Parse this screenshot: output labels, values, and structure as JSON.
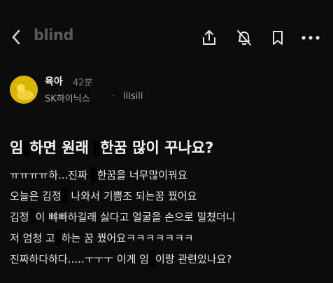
{
  "header": {
    "logo": "blind",
    "icons": [
      "back-chevron-icon",
      "share-icon",
      "bell-off-icon",
      "bookmark-icon",
      "more-icon"
    ]
  },
  "author": {
    "name": "육아",
    "time": "42분",
    "company": "SK하이닉스",
    "separator": "·",
    "nickname": "lilsili"
  },
  "post": {
    "title": [
      "임",
      "하면 원래 ",
      "한꿈 많이 꾸나요?"
    ],
    "lines": [
      [
        "ㅠㅠㅠㅠ하...진짜 ",
        "한꿈을 너무많이꿔요"
      ],
      [
        "오늘은 김정",
        " 나와서 기쁨조 되는꿈 꿨어요"
      ],
      [
        "김정",
        "이 뺘빠하길래 싫다고 얼굴을 손으로 밀쳤더니"
      ],
      [
        "저 엄청 고",
        "하는 꿈 꿨어요ㅋㅋㅋㅋㅋㅋㅋ"
      ],
      [
        "진짜하다하다.....ㅜㅜㅜ 이게 임",
        "이랑 관련있나요?"
      ]
    ]
  },
  "colors": {
    "background": "#0b0b0b",
    "logo": "#5a5a5a",
    "avatar": "#d9b400",
    "muted": "#a8a8a8"
  }
}
